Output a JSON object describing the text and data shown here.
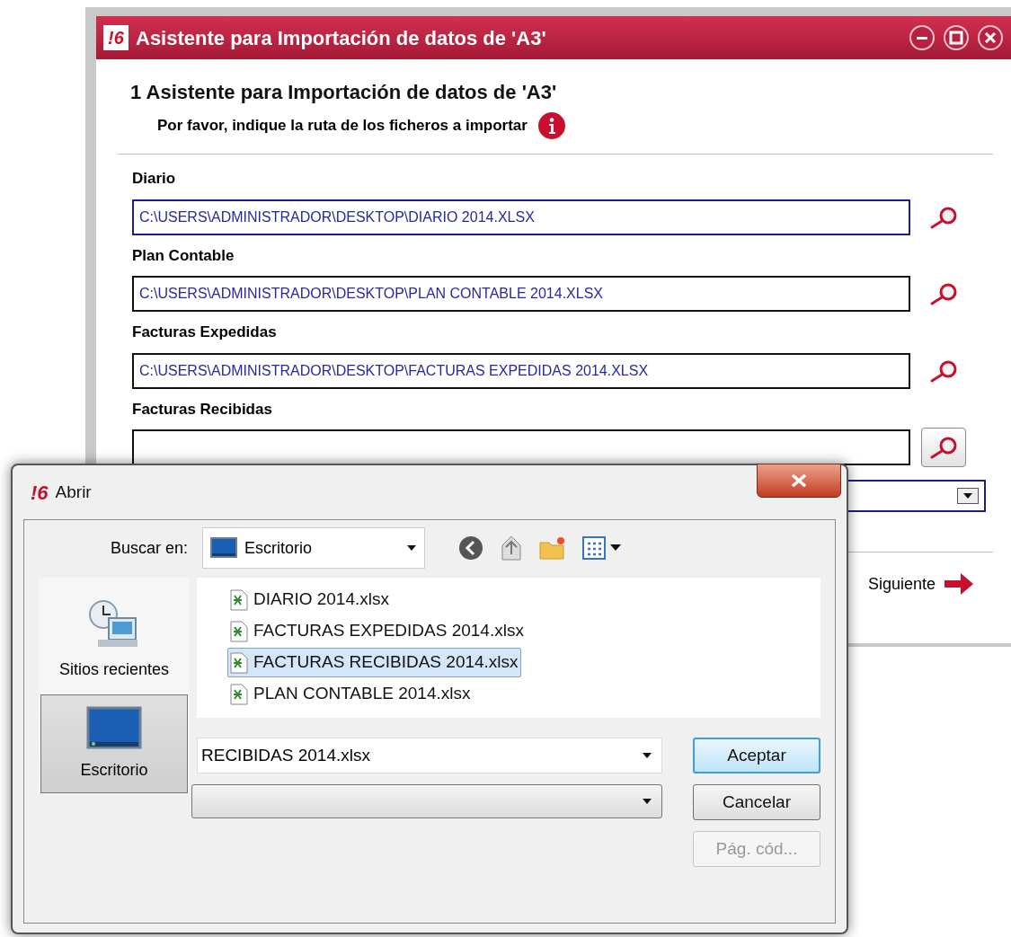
{
  "main_window": {
    "logo": "!6",
    "title": "Asistente para Importación de datos de 'A3'",
    "heading": "1 Asistente para Importación de datos de 'A3'",
    "subtitle": "Por favor, indique la ruta de los ficheros a importar",
    "fields": [
      {
        "label": "Diario",
        "value": "C:\\USERS\\ADMINISTRADOR\\DESKTOP\\DIARIO 2014.XLSX",
        "focused": true,
        "kind": "link"
      },
      {
        "label": "Plan Contable",
        "value": "C:\\USERS\\ADMINISTRADOR\\DESKTOP\\PLAN CONTABLE 2014.XLSX",
        "focused": false,
        "kind": "link"
      },
      {
        "label": "Facturas Expedidas",
        "value": "C:\\USERS\\ADMINISTRADOR\\DESKTOP\\FACTURAS EXPEDIDAS 2014.XLSX",
        "focused": false,
        "kind": "link"
      },
      {
        "label": "Facturas Recibidas",
        "focused": false,
        "kind": "button"
      }
    ],
    "next_label": "Siguiente"
  },
  "dialog": {
    "logo": "!6",
    "title": "Abrir",
    "look_in_label": "Buscar en:",
    "look_in_value": "Escritorio",
    "places": [
      {
        "label": "Sitios recientes",
        "kind": "recent",
        "selected": false
      },
      {
        "label": "Escritorio",
        "kind": "desktop",
        "selected": true
      }
    ],
    "files": [
      {
        "name": "DIARIO 2014.xlsx",
        "selected": false
      },
      {
        "name": "FACTURAS EXPEDIDAS 2014.xlsx",
        "selected": false
      },
      {
        "name": "FACTURAS RECIBIDAS 2014.xlsx",
        "selected": true
      },
      {
        "name": "PLAN CONTABLE 2014.xlsx",
        "selected": false
      }
    ],
    "filename": "RECIBIDAS 2014.xlsx",
    "buttons": [
      {
        "label": "Aceptar",
        "kind": "default",
        "disabled": false
      },
      {
        "label": "Cancelar",
        "kind": "normal",
        "disabled": false
      },
      {
        "label": "Pág. cód...",
        "kind": "normal",
        "disabled": true
      }
    ]
  }
}
